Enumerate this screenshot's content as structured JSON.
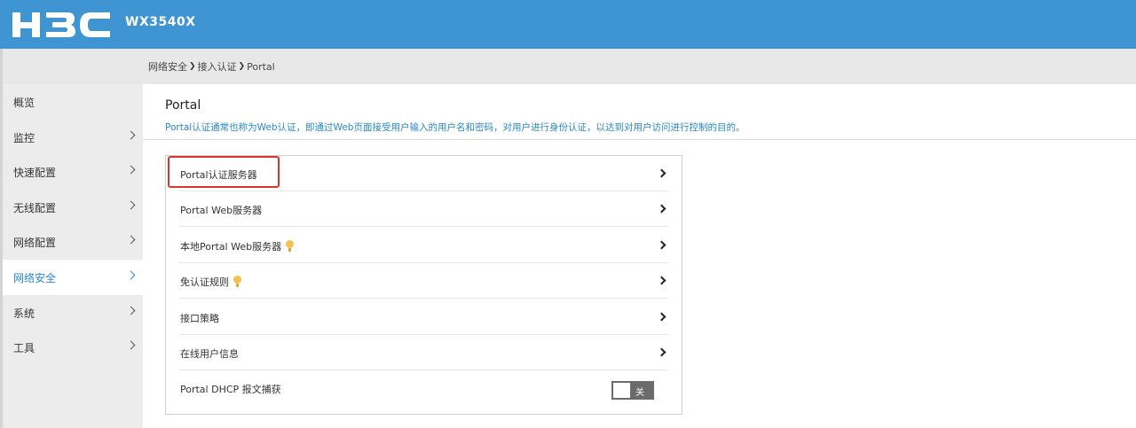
{
  "header": {
    "logo_text": "H3C",
    "model": "WX3540X",
    "colors": {
      "header_bg": "#3e95d1",
      "accent": "#2a89c9",
      "highlight": "#d9352e"
    }
  },
  "breadcrumb": [
    "网络安全",
    "接入认证",
    "Portal"
  ],
  "sidebar": {
    "items": [
      {
        "label": "概览",
        "has_chevron": false,
        "active": false
      },
      {
        "label": "监控",
        "has_chevron": true,
        "active": false
      },
      {
        "label": "快速配置",
        "has_chevron": true,
        "active": false
      },
      {
        "label": "无线配置",
        "has_chevron": true,
        "active": false
      },
      {
        "label": "网络配置",
        "has_chevron": true,
        "active": false
      },
      {
        "label": "网络安全",
        "has_chevron": true,
        "active": true
      },
      {
        "label": "系统",
        "has_chevron": true,
        "active": false
      },
      {
        "label": "工具",
        "has_chevron": true,
        "active": false
      }
    ]
  },
  "page": {
    "title": "Portal",
    "description": "Portal认证通常也称为Web认证，即通过Web页面接受用户输入的用户名和密码，对用户进行身份认证，以达到对用户访问进行控制的目的。"
  },
  "panel": {
    "rows": [
      {
        "label": "Portal认证服务器",
        "icon": "chevron-right-icon",
        "bulb": false,
        "highlighted": true
      },
      {
        "label": "Portal Web服务器",
        "icon": "chevron-right-icon",
        "bulb": false
      },
      {
        "label": "本地Portal Web服务器",
        "icon": "chevron-right-icon",
        "bulb": true
      },
      {
        "label": "免认证规则",
        "icon": "chevron-right-icon",
        "bulb": true
      },
      {
        "label": "接口策略",
        "icon": "chevron-right-icon",
        "bulb": false
      },
      {
        "label": "在线用户信息",
        "icon": "chevron-right-icon",
        "bulb": false
      },
      {
        "label": "Portal DHCP 报文捕获",
        "icon": "toggle",
        "bulb": false
      }
    ],
    "dhcp_toggle": {
      "state": "off",
      "label": "关"
    }
  }
}
